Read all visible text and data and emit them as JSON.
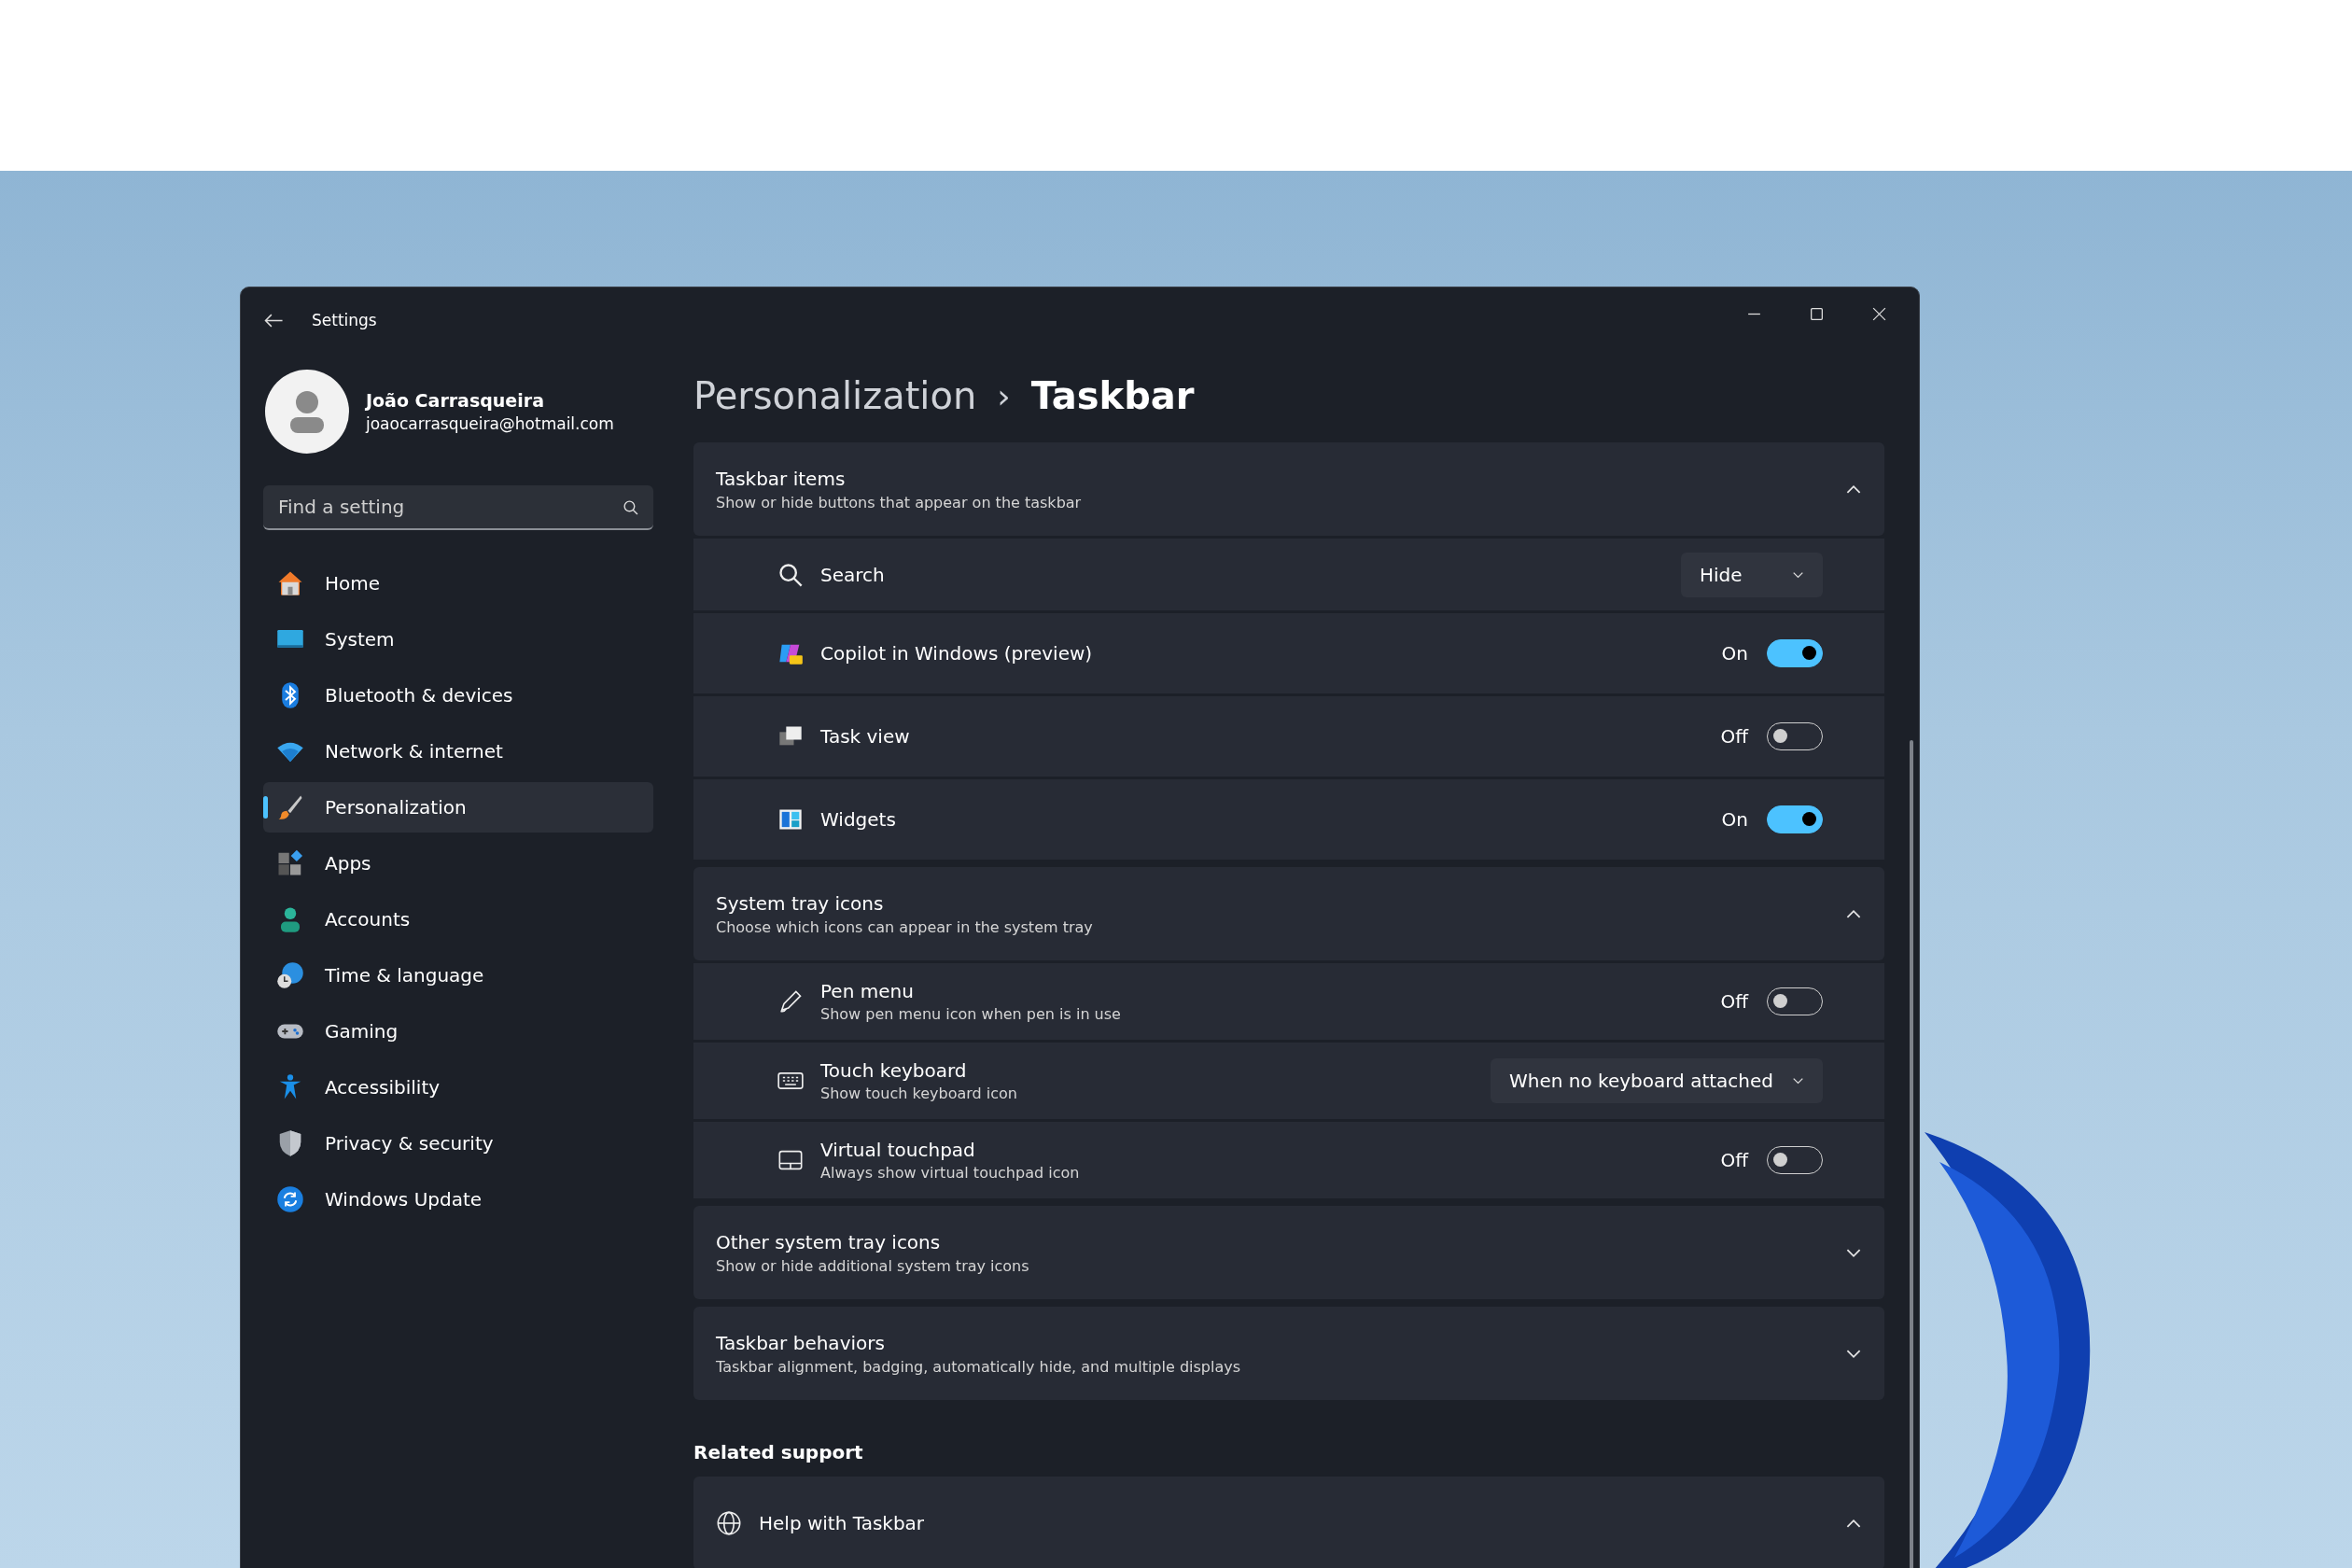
{
  "window": {
    "title": "Settings"
  },
  "account": {
    "name": "João Carrasqueira",
    "email": "joaocarrasqueira@hotmail.com"
  },
  "search": {
    "placeholder": "Find a setting"
  },
  "sidebar": {
    "items": [
      {
        "label": "Home",
        "selected": false
      },
      {
        "label": "System",
        "selected": false
      },
      {
        "label": "Bluetooth & devices",
        "selected": false
      },
      {
        "label": "Network & internet",
        "selected": false
      },
      {
        "label": "Personalization",
        "selected": true
      },
      {
        "label": "Apps",
        "selected": false
      },
      {
        "label": "Accounts",
        "selected": false
      },
      {
        "label": "Time & language",
        "selected": false
      },
      {
        "label": "Gaming",
        "selected": false
      },
      {
        "label": "Accessibility",
        "selected": false
      },
      {
        "label": "Privacy & security",
        "selected": false
      },
      {
        "label": "Windows Update",
        "selected": false
      }
    ]
  },
  "breadcrumb": {
    "parent": "Personalization",
    "separator": "›",
    "current": "Taskbar"
  },
  "sections": [
    {
      "title": "Taskbar items",
      "subtitle": "Show or hide buttons that appear on the taskbar",
      "expanded": true,
      "rows": [
        {
          "kind": "dropdown",
          "label": "Search",
          "value": "Hide"
        },
        {
          "kind": "toggle",
          "label": "Copilot in Windows (preview)",
          "state": "On",
          "on": true
        },
        {
          "kind": "toggle",
          "label": "Task view",
          "state": "Off",
          "on": false
        },
        {
          "kind": "toggle",
          "label": "Widgets",
          "state": "On",
          "on": true
        }
      ]
    },
    {
      "title": "System tray icons",
      "subtitle": "Choose which icons can appear in the system tray",
      "expanded": true,
      "rows": [
        {
          "kind": "toggle",
          "label": "Pen menu",
          "description": "Show pen menu icon when pen is in use",
          "state": "Off",
          "on": false
        },
        {
          "kind": "dropdown",
          "label": "Touch keyboard",
          "description": "Show touch keyboard icon",
          "value": "When no keyboard attached"
        },
        {
          "kind": "toggle",
          "label": "Virtual touchpad",
          "description": "Always show virtual touchpad icon",
          "state": "Off",
          "on": false
        }
      ]
    },
    {
      "title": "Other system tray icons",
      "subtitle": "Show or hide additional system tray icons",
      "expanded": false
    },
    {
      "title": "Taskbar behaviors",
      "subtitle": "Taskbar alignment, badging, automatically hide, and multiple displays",
      "expanded": false
    }
  ],
  "related_support": {
    "heading": "Related support",
    "items": [
      {
        "label": "Help with Taskbar",
        "expanded": true
      }
    ]
  }
}
